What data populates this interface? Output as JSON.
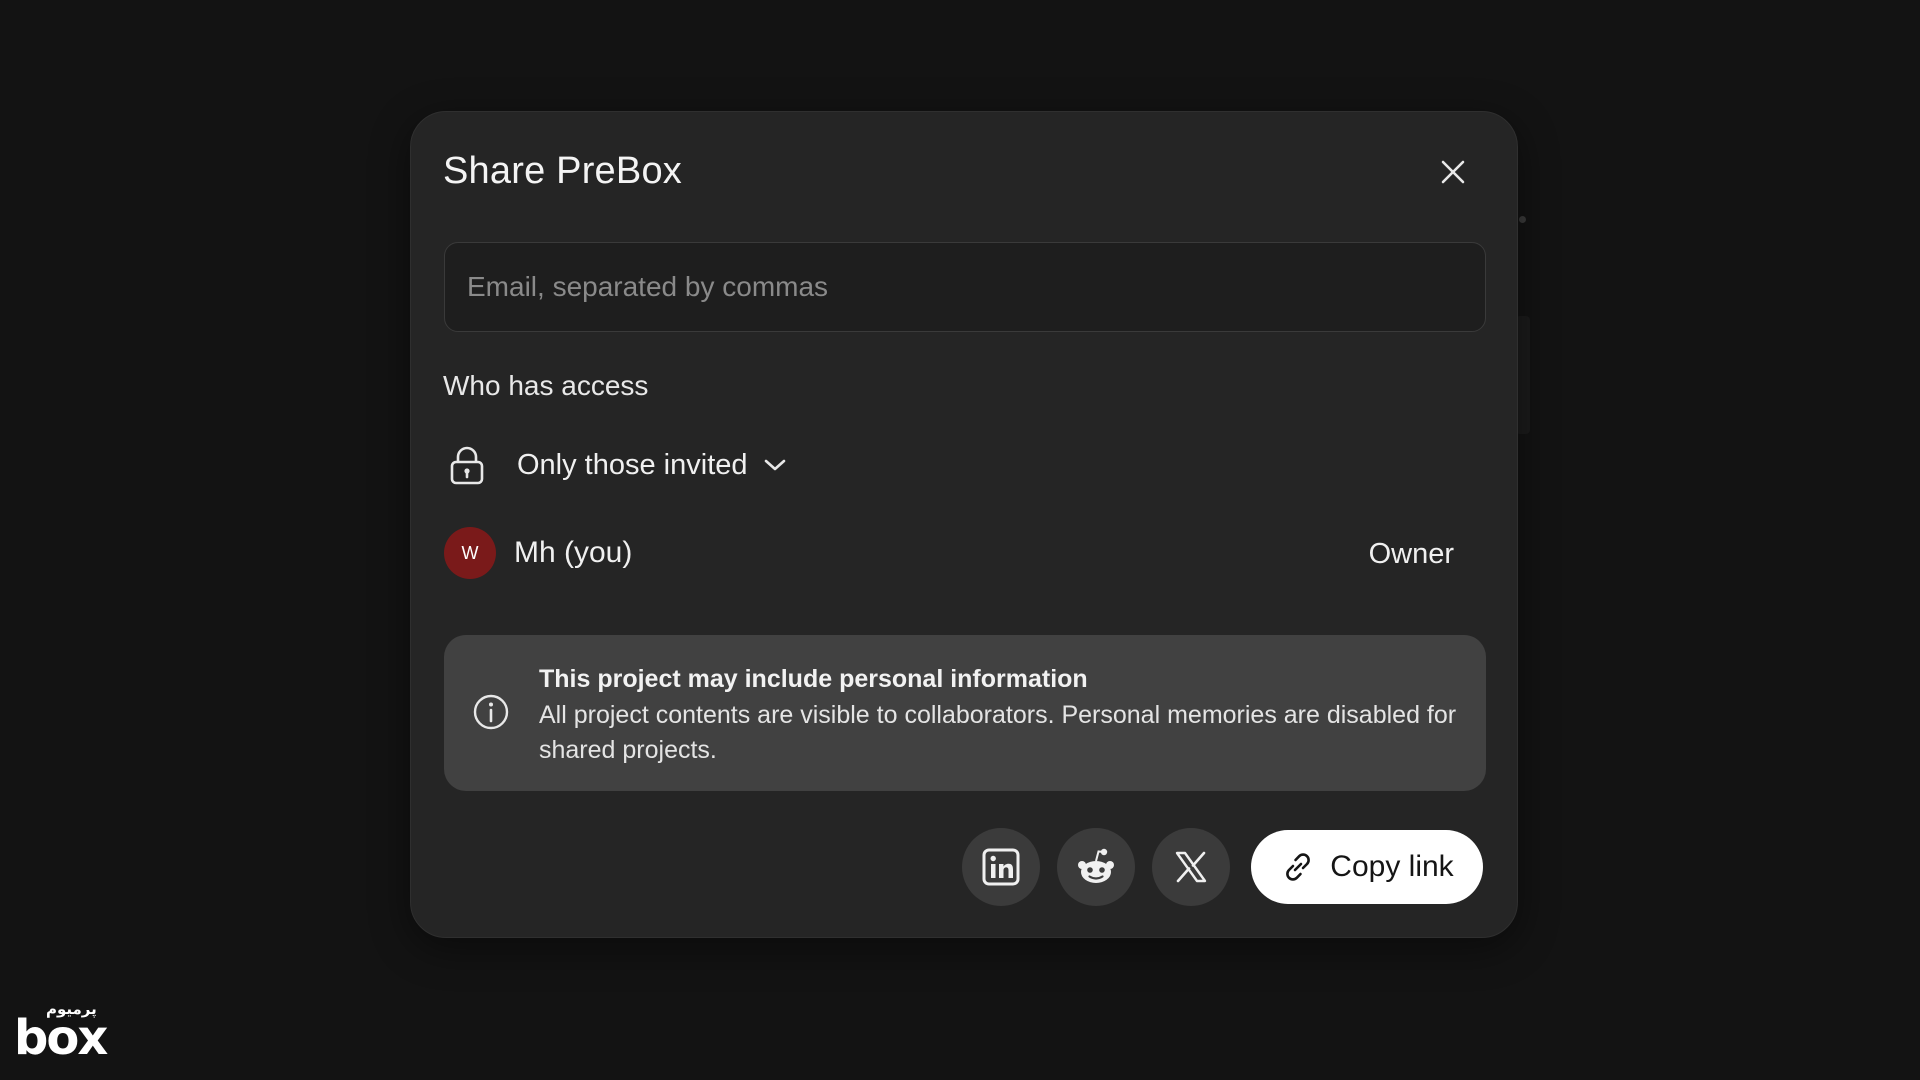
{
  "dialog": {
    "title": "Share PreBox",
    "close_icon": "close-icon"
  },
  "invite": {
    "placeholder": "Email, separated by commas",
    "value": ""
  },
  "access": {
    "section_label": "Who has access",
    "mode_icon": "lock-icon",
    "mode_label": "Only those invited",
    "dropdown_icon": "chevron-down-icon"
  },
  "members": [
    {
      "initial": "W",
      "name": "Mh (you)",
      "role": "Owner",
      "avatar_color": "#7a1a1a"
    }
  ],
  "notice": {
    "icon": "info-icon",
    "heading": "This project may include personal information",
    "body": "All project contents are visible to collaborators. Personal memories are disabled for shared projects."
  },
  "share_actions": {
    "linkedin_icon": "linkedin-icon",
    "reddit_icon": "reddit-icon",
    "x_icon": "x-icon",
    "copy_link_icon": "link-icon",
    "copy_link_label": "Copy link"
  },
  "watermark": {
    "sub": "پرمیوم",
    "main": "box"
  },
  "colors": {
    "background": "#131313",
    "modal": "#252525",
    "notice": "#414141",
    "primary_button": "#ffffff",
    "avatar": "#7a1a1a"
  }
}
